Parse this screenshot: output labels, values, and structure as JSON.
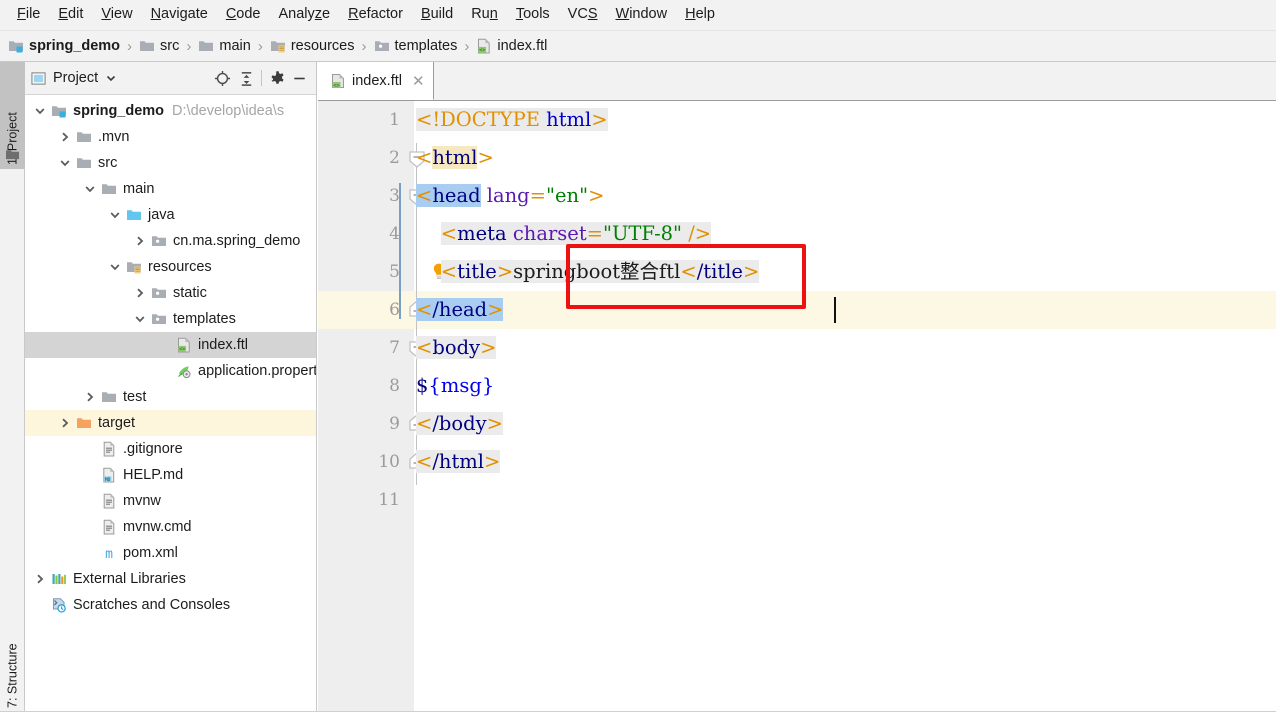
{
  "menu": {
    "items": [
      {
        "label": "File",
        "accel": "F"
      },
      {
        "label": "Edit",
        "accel": "E"
      },
      {
        "label": "View",
        "accel": "V"
      },
      {
        "label": "Navigate",
        "accel": "N"
      },
      {
        "label": "Code",
        "accel": "C"
      },
      {
        "label": "Analyze",
        "accel": "z"
      },
      {
        "label": "Refactor",
        "accel": "R"
      },
      {
        "label": "Build",
        "accel": "B"
      },
      {
        "label": "Run",
        "accel": "n"
      },
      {
        "label": "Tools",
        "accel": "T"
      },
      {
        "label": "VCS",
        "accel": "S"
      },
      {
        "label": "Window",
        "accel": "W"
      },
      {
        "label": "Help",
        "accel": "H"
      }
    ]
  },
  "breadcrumb": {
    "separator": "›",
    "items": [
      {
        "label": "spring_demo",
        "icon": "module-folder-icon",
        "bold": true
      },
      {
        "label": "src",
        "icon": "folder-icon",
        "bold": false
      },
      {
        "label": "main",
        "icon": "folder-icon",
        "bold": false
      },
      {
        "label": "resources",
        "icon": "resources-folder-icon",
        "bold": false
      },
      {
        "label": "templates",
        "icon": "package-folder-icon",
        "bold": false
      },
      {
        "label": "index.ftl",
        "icon": "ftl-file-icon",
        "bold": false
      }
    ]
  },
  "tool_strip": {
    "project_tab": "1: Project",
    "project_tab_accel": "1",
    "structure_tab": "7: Structure",
    "structure_tab_accel": "7"
  },
  "project_panel": {
    "title": "Project",
    "dropdown_icon": "chevron-down-icon",
    "toolbar_icons": [
      "locate-target-icon",
      "collapse-all-icon",
      "settings-gear-icon",
      "hide-minimize-icon"
    ],
    "tree": [
      {
        "label": "spring_demo",
        "path": "D:\\develop\\idea\\s",
        "depth": 0,
        "arrow": "down",
        "icon": "module-folder-icon",
        "bold": true,
        "state": "normal"
      },
      {
        "label": ".mvn",
        "path": "",
        "depth": 1,
        "arrow": "right",
        "icon": "folder-icon",
        "bold": false,
        "state": "normal"
      },
      {
        "label": "src",
        "path": "",
        "depth": 1,
        "arrow": "down",
        "icon": "folder-icon",
        "bold": false,
        "state": "normal"
      },
      {
        "label": "main",
        "path": "",
        "depth": 2,
        "arrow": "down",
        "icon": "folder-icon",
        "bold": false,
        "state": "normal"
      },
      {
        "label": "java",
        "path": "",
        "depth": 3,
        "arrow": "down",
        "icon": "source-folder-icon",
        "bold": false,
        "state": "normal"
      },
      {
        "label": "cn.ma.spring_demo",
        "path": "",
        "depth": 4,
        "arrow": "right",
        "icon": "package-folder-icon",
        "bold": false,
        "state": "normal"
      },
      {
        "label": "resources",
        "path": "",
        "depth": 3,
        "arrow": "down",
        "icon": "resources-folder-icon",
        "bold": false,
        "state": "normal"
      },
      {
        "label": "static",
        "path": "",
        "depth": 4,
        "arrow": "right",
        "icon": "package-folder-icon",
        "bold": false,
        "state": "normal"
      },
      {
        "label": "templates",
        "path": "",
        "depth": 4,
        "arrow": "down",
        "icon": "package-folder-icon",
        "bold": false,
        "state": "normal"
      },
      {
        "label": "index.ftl",
        "path": "",
        "depth": 5,
        "arrow": "none",
        "icon": "ftl-file-icon",
        "bold": false,
        "state": "selected"
      },
      {
        "label": "application.propert",
        "path": "",
        "depth": 5,
        "arrow": "none",
        "icon": "properties-file-icon",
        "bold": false,
        "state": "normal"
      },
      {
        "label": "test",
        "path": "",
        "depth": 2,
        "arrow": "right",
        "icon": "folder-icon",
        "bold": false,
        "state": "normal"
      },
      {
        "label": "target",
        "path": "",
        "depth": 1,
        "arrow": "right",
        "icon": "excluded-folder-icon",
        "bold": false,
        "state": "excluded"
      },
      {
        "label": ".gitignore",
        "path": "",
        "depth": 2,
        "arrow": "none",
        "icon": "text-file-icon",
        "bold": false,
        "state": "normal"
      },
      {
        "label": "HELP.md",
        "path": "",
        "depth": 2,
        "arrow": "none",
        "icon": "markdown-file-icon",
        "bold": false,
        "state": "normal"
      },
      {
        "label": "mvnw",
        "path": "",
        "depth": 2,
        "arrow": "none",
        "icon": "text-file-icon",
        "bold": false,
        "state": "normal"
      },
      {
        "label": "mvnw.cmd",
        "path": "",
        "depth": 2,
        "arrow": "none",
        "icon": "text-file-icon",
        "bold": false,
        "state": "normal"
      },
      {
        "label": "pom.xml",
        "path": "",
        "depth": 2,
        "arrow": "none",
        "icon": "maven-file-icon",
        "bold": false,
        "state": "normal"
      },
      {
        "label": "External Libraries",
        "path": "",
        "depth": 0,
        "arrow": "right",
        "icon": "libraries-icon",
        "bold": false,
        "state": "normal"
      },
      {
        "label": "Scratches and Consoles",
        "path": "",
        "depth": 0,
        "arrow": "none",
        "icon": "scratches-icon",
        "bold": false,
        "state": "normal"
      }
    ]
  },
  "editor": {
    "tab": {
      "label": "index.ftl",
      "icon": "ftl-file-icon",
      "close_icon": "close-icon"
    },
    "caret_line": 6,
    "line_numbers": [
      "1",
      "2",
      "3",
      "4",
      "5",
      "6",
      "7",
      "8",
      "9",
      "10",
      "11"
    ],
    "intention_bulb": {
      "line": 5,
      "icon": "lightbulb-icon"
    },
    "fold_lines": [
      2,
      3,
      6,
      7,
      9,
      10
    ],
    "code_lines": [
      {
        "n": 1,
        "text": "<!DOCTYPE html>"
      },
      {
        "n": 2,
        "text": "<html>"
      },
      {
        "n": 3,
        "text": "<head lang=\"en\">"
      },
      {
        "n": 4,
        "text": "    <meta charset=\"UTF-8\" />"
      },
      {
        "n": 5,
        "text": "    <title>springboot整合ftl</title>"
      },
      {
        "n": 6,
        "text": "</head>"
      },
      {
        "n": 7,
        "text": "<body>"
      },
      {
        "n": 8,
        "text": "${msg}"
      },
      {
        "n": 9,
        "text": "</body>"
      },
      {
        "n": 10,
        "text": "</html>"
      },
      {
        "n": 11,
        "text": ""
      }
    ],
    "annotation": {
      "shape": "rectangle",
      "color": "#ee1111",
      "target_text": "springboot整合ftl"
    }
  },
  "colors": {
    "tag": "#000080",
    "punct": "#e09000",
    "attribute": "#5b19b0",
    "string": "#008000",
    "variable": "#0000ee",
    "selection_blue": "#a8cdf0",
    "match_yellow": "#f6e9bf",
    "caret_line": "#fdf8e3",
    "excluded_row": "#fdf6dd",
    "annotation_red": "#ee1111"
  }
}
